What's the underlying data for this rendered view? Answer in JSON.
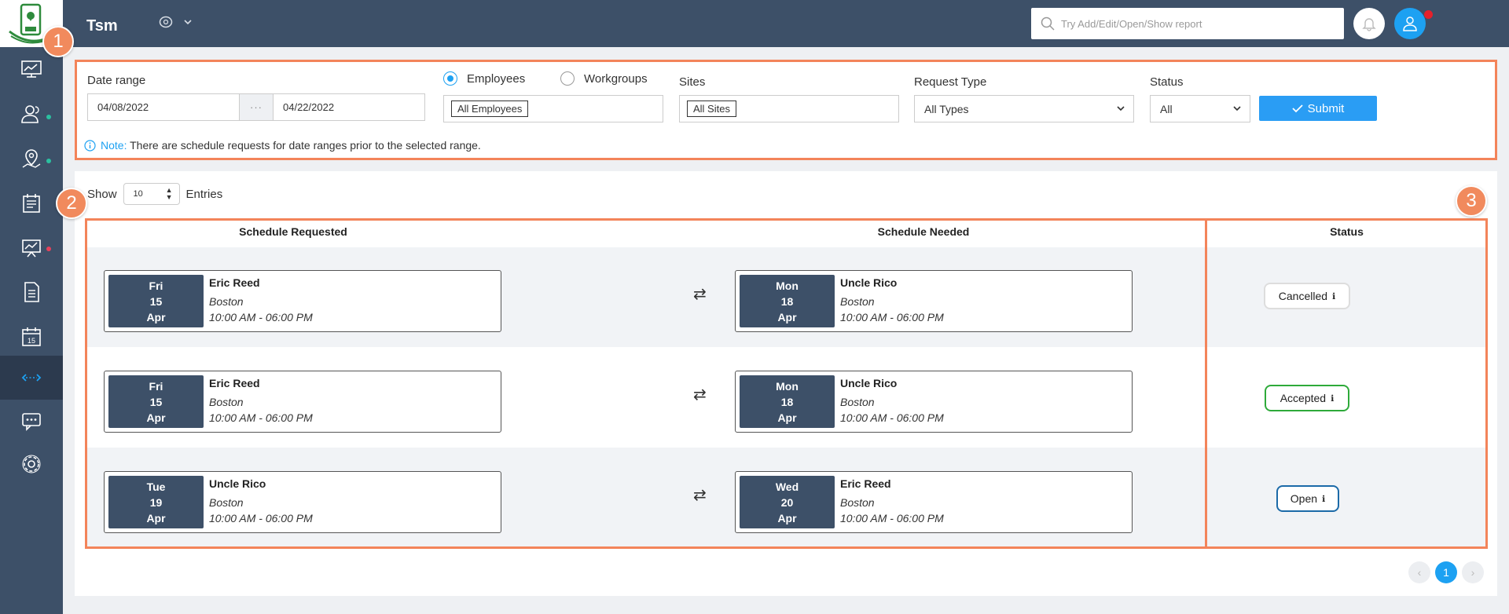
{
  "header": {
    "title": "Tsm",
    "search_placeholder": "Try Add/Edit/Open/Show report"
  },
  "callouts": [
    "1",
    "2",
    "3"
  ],
  "filters": {
    "date_range_label": "Date range",
    "date_from": "04/08/2022",
    "date_sep": "···",
    "date_to": "04/22/2022",
    "radio_employees": "Employees",
    "radio_workgroups": "Workgroups",
    "employees_tag": "All Employees",
    "sites_label": "Sites",
    "sites_tag": "All Sites",
    "request_type_label": "Request Type",
    "request_type_value": "All Types",
    "status_label": "Status",
    "status_value": "All",
    "submit_label": "Submit",
    "note_label": "Note:",
    "note_text": "There are schedule requests for date ranges prior to the selected range."
  },
  "table": {
    "show_label": "Show",
    "entries_value": "10",
    "entries_label": "Entries",
    "col_requested": "Schedule Requested",
    "col_needed": "Schedule Needed",
    "col_status": "Status",
    "rows": [
      {
        "req": {
          "day": "Fri",
          "date": "15",
          "month": "Apr",
          "name": "Eric Reed",
          "location": "Boston",
          "time": "10:00 AM - 06:00 PM"
        },
        "need": {
          "day": "Mon",
          "date": "18",
          "month": "Apr",
          "name": "Uncle Rico",
          "location": "Boston",
          "time": "10:00 AM - 06:00 PM"
        },
        "status": "Cancelled"
      },
      {
        "req": {
          "day": "Fri",
          "date": "15",
          "month": "Apr",
          "name": "Eric Reed",
          "location": "Boston",
          "time": "10:00 AM - 06:00 PM"
        },
        "need": {
          "day": "Mon",
          "date": "18",
          "month": "Apr",
          "name": "Uncle Rico",
          "location": "Boston",
          "time": "10:00 AM - 06:00 PM"
        },
        "status": "Accepted"
      },
      {
        "req": {
          "day": "Tue",
          "date": "19",
          "month": "Apr",
          "name": "Uncle Rico",
          "location": "Boston",
          "time": "10:00 AM - 06:00 PM"
        },
        "need": {
          "day": "Wed",
          "date": "20",
          "month": "Apr",
          "name": "Eric Reed",
          "location": "Boston",
          "time": "10:00 AM - 06:00 PM"
        },
        "status": "Open"
      }
    ],
    "swap_glyph": "⇄",
    "info_glyph": "ℹ"
  },
  "pagination": {
    "prev": "‹",
    "current": "1",
    "next": "›"
  },
  "colors": {
    "nav_bg": "#3d5068",
    "accent": "#1da1f2",
    "highlight": "#f3845a",
    "status_cancelled": "#dddddd",
    "status_accepted": "#2eaa3a",
    "status_open": "#1c6aa8"
  },
  "icons": {
    "sidebar": [
      "dashboard-icon",
      "users-icon",
      "location-icon",
      "schedule-icon",
      "presentation-icon",
      "document-icon",
      "calendar-icon",
      "swap-requests-icon",
      "messages-icon",
      "settings-icon"
    ],
    "calendar_day": "15"
  }
}
